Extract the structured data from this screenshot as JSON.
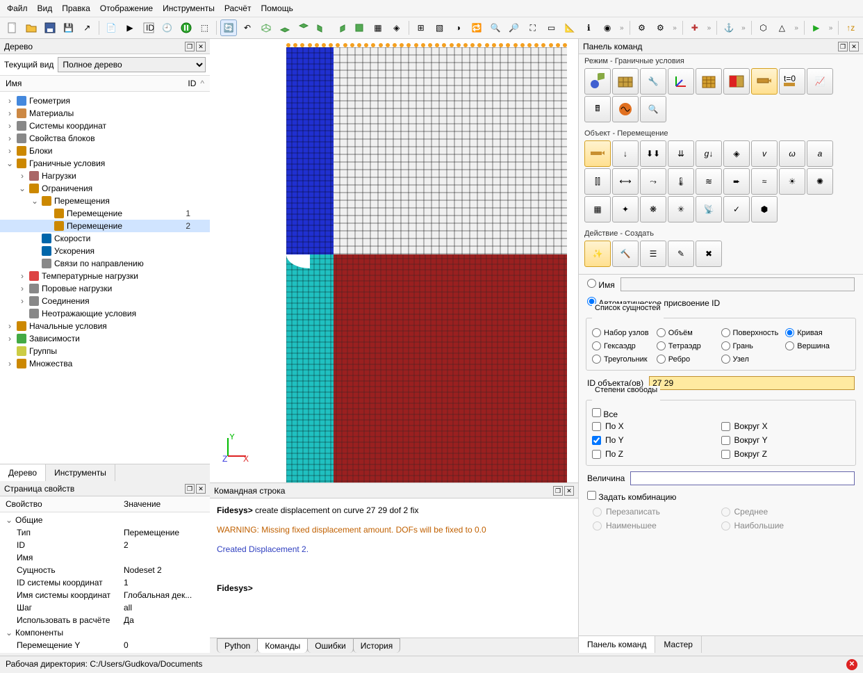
{
  "menu": [
    "Файл",
    "Вид",
    "Правка",
    "Отображение",
    "Инструменты",
    "Расчёт",
    "Помощь"
  ],
  "panels": {
    "tree": "Дерево",
    "cmdPanel": "Панель команд",
    "props": "Страница свойств",
    "cmdline": "Командная строка"
  },
  "view": {
    "label": "Текущий вид",
    "value": "Полное дерево"
  },
  "treeHdr": {
    "name": "Имя",
    "id": "ID"
  },
  "tree": [
    {
      "exp": "›",
      "lvl": 0,
      "ico": "geom",
      "txt": "Геометрия"
    },
    {
      "exp": "›",
      "lvl": 0,
      "ico": "mat",
      "txt": "Материалы"
    },
    {
      "exp": "›",
      "lvl": 0,
      "ico": "cs",
      "txt": "Системы координат"
    },
    {
      "exp": "›",
      "lvl": 0,
      "ico": "bp",
      "txt": "Свойства блоков"
    },
    {
      "exp": "›",
      "lvl": 0,
      "ico": "blk",
      "txt": "Блоки"
    },
    {
      "exp": "⌄",
      "lvl": 0,
      "ico": "bc",
      "txt": "Граничные условия"
    },
    {
      "exp": "›",
      "lvl": 1,
      "ico": "load",
      "txt": "Нагрузки"
    },
    {
      "exp": "⌄",
      "lvl": 1,
      "ico": "con",
      "txt": "Ограничения"
    },
    {
      "exp": "⌄",
      "lvl": 2,
      "ico": "disp",
      "txt": "Перемещения"
    },
    {
      "exp": "",
      "lvl": 3,
      "ico": "disp",
      "txt": "Перемещение",
      "num": "1"
    },
    {
      "exp": "",
      "lvl": 3,
      "ico": "disp",
      "txt": "Перемещение",
      "num": "2",
      "sel": true
    },
    {
      "exp": "",
      "lvl": 2,
      "ico": "vel",
      "txt": "Скорости"
    },
    {
      "exp": "",
      "lvl": 2,
      "ico": "acc",
      "txt": "Ускорения"
    },
    {
      "exp": "",
      "lvl": 2,
      "ico": "dir",
      "txt": "Связи по направлению"
    },
    {
      "exp": "›",
      "lvl": 1,
      "ico": "temp",
      "txt": "Температурные нагрузки"
    },
    {
      "exp": "›",
      "lvl": 1,
      "ico": "pore",
      "txt": "Поровые нагрузки"
    },
    {
      "exp": "›",
      "lvl": 1,
      "ico": "join",
      "txt": "Соединения"
    },
    {
      "exp": "",
      "lvl": 1,
      "ico": "nref",
      "txt": "Неотражающие условия"
    },
    {
      "exp": "›",
      "lvl": 0,
      "ico": "init",
      "txt": "Начальные условия"
    },
    {
      "exp": "›",
      "lvl": 0,
      "ico": "dep",
      "txt": "Зависимости"
    },
    {
      "exp": "",
      "lvl": 0,
      "ico": "grp",
      "txt": "Группы"
    },
    {
      "exp": "›",
      "lvl": 0,
      "ico": "set",
      "txt": "Множества"
    }
  ],
  "leftTabs": [
    "Дерево",
    "Инструменты"
  ],
  "propHdr": {
    "k": "Свойство",
    "v": "Значение"
  },
  "props": [
    {
      "grp": "Общие"
    },
    {
      "k": "Тип",
      "v": "Перемещение"
    },
    {
      "k": "ID",
      "v": "2"
    },
    {
      "k": "Имя",
      "v": ""
    },
    {
      "k": "Сущность",
      "v": "Nodeset 2"
    },
    {
      "k": "ID системы координат",
      "v": "1"
    },
    {
      "k": "Имя системы координат",
      "v": "Глобальная дек..."
    },
    {
      "k": "Шаг",
      "v": "all"
    },
    {
      "k": "Использовать в расчёте",
      "v": "Да"
    },
    {
      "grp": "Компоненты"
    },
    {
      "k": "Перемещение Y",
      "v": "0"
    }
  ],
  "cmd": {
    "prompt": "Fidesys>",
    "line": "create displacement  on curve 27 29 dof 2 fix",
    "warn": "WARNING: Missing fixed displacement amount. DOFs will be fixed to 0.0",
    "result": "Created Displacement 2."
  },
  "cmdTabs": [
    "Python",
    "Команды",
    "Ошибки",
    "История"
  ],
  "mode": {
    "label": "Режим - Граничные условия"
  },
  "obj": {
    "label": "Объект - Перемещение"
  },
  "act": {
    "label": "Действие - Создать"
  },
  "form": {
    "name": "Имя",
    "autoId": "Автоматическое присвоение ID",
    "entList": "Список сущностей",
    "entities": [
      "Набор узлов",
      "Объём",
      "Поверхность",
      "Кривая",
      "Гексаэдр",
      "Тетраэдр",
      "Грань",
      "Вершина",
      "Треугольник",
      "Ребро",
      "Узел"
    ],
    "entitySel": "Кривая",
    "idLabel": "ID объекта(ов)",
    "idVal": "27 29",
    "dof": "Степени свободы",
    "all": "Все",
    "dofs": [
      "По X",
      "Вокруг X",
      "По Y",
      "Вокруг Y",
      "По Z",
      "Вокруг Z"
    ],
    "dofChecked": [
      "По Y"
    ],
    "mag": "Величина",
    "combo": "Задать комбинацию",
    "combos": [
      "Перезаписать",
      "Среднее",
      "Наименьшее",
      "Наибольшие"
    ]
  },
  "rightTabs": [
    "Панель команд",
    "Мастер"
  ],
  "status": "Рабочая директория: C:/Users/Gudkova/Documents",
  "iconTips": [
    "new",
    "open",
    "save",
    "save-as",
    "import",
    "journal",
    "play-journal",
    "play-id",
    "history",
    "pause",
    "surface-mesh",
    "rotate",
    "undo-view",
    "iso",
    "front",
    "back",
    "left",
    "right",
    "top",
    "bottom",
    "persp",
    "clip",
    "grid",
    "box",
    "toggle",
    "refresh",
    "zoom-in",
    "zoom-out",
    "fit",
    "bounds",
    "measure",
    "info",
    "entity",
    "gear",
    "settings",
    "axis-add",
    "anchor",
    "hex",
    "tri",
    "play",
    "z-up"
  ]
}
